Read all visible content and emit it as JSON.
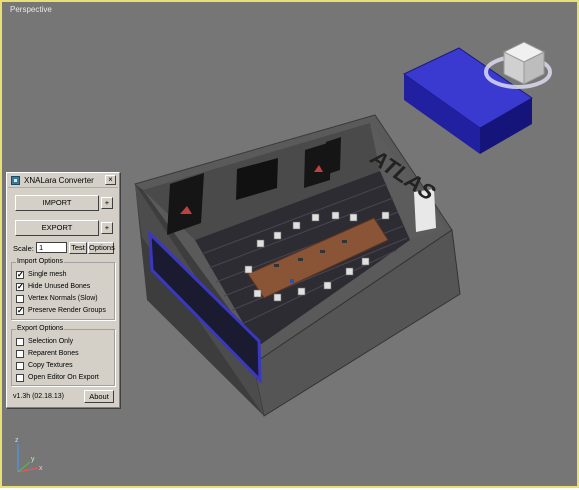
{
  "viewport": {
    "label": "Perspective",
    "border_color": "#e8e070",
    "background": "#767676"
  },
  "scene": {
    "logo_text": "ATLAS"
  },
  "panel": {
    "title": "XNALara Converter",
    "close_label": "×",
    "import_label": "IMPORT",
    "import_plus": "+",
    "export_label": "EXPORT",
    "export_plus": "+",
    "scale_label": "Scale:",
    "scale_value": "1",
    "test_label": "Test",
    "options_label": "Options",
    "import_options": {
      "label": "Import Options",
      "items": [
        {
          "label": "Single mesh",
          "checked": true
        },
        {
          "label": "Hide Unused Bones",
          "checked": true
        },
        {
          "label": "Vertex Normals (Slow)",
          "checked": false
        },
        {
          "label": "Preserve Render Groups",
          "checked": true
        }
      ]
    },
    "export_options": {
      "label": "Export Options",
      "items": [
        {
          "label": "Selection Only",
          "checked": false
        },
        {
          "label": "Reparent Bones",
          "checked": false
        },
        {
          "label": "Copy Textures",
          "checked": false
        },
        {
          "label": "Open Editor On Export",
          "checked": false
        }
      ]
    },
    "version": "v1.3h  (02.18.13)",
    "about_label": "About"
  },
  "axis": {
    "x_label": "x",
    "y_label": "y",
    "z_label": "z"
  }
}
